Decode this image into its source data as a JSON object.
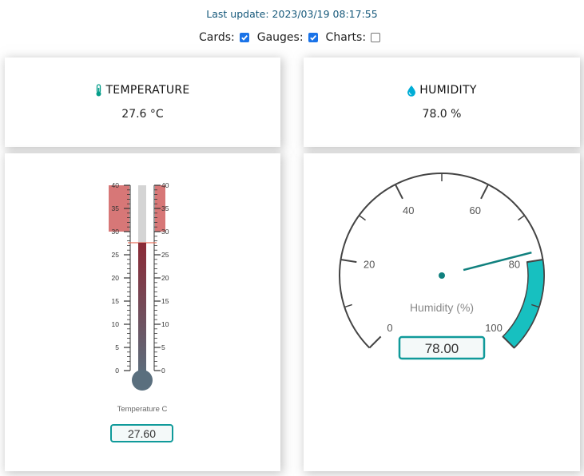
{
  "header": {
    "last_update": "Last update: 2023/03/19 08:17:55"
  },
  "toggles": [
    {
      "label": "Cards:",
      "checked": true
    },
    {
      "label": "Gauges:",
      "checked": true
    },
    {
      "label": "Charts:",
      "checked": false
    }
  ],
  "cards": {
    "temperature": {
      "title": "TEMPERATURE",
      "value": "27.6 °C",
      "icon": "thermometer-icon",
      "icon_color": "#059e8a"
    },
    "humidity": {
      "title": "HUMIDITY",
      "value": "78.0 %",
      "icon": "water-drop-icon",
      "icon_color": "#00add6"
    }
  },
  "thermometer": {
    "value": 27.6,
    "min": 0,
    "max": 40,
    "major_ticks": [
      "0",
      "5",
      "10",
      "15",
      "20",
      "25",
      "30",
      "35",
      "40"
    ],
    "highlight_from": 30,
    "highlight_to": 40,
    "caption": "Temperature C",
    "readout": "27.60",
    "colors": {
      "fill_top": "#8b2a36",
      "fill_bottom": "#5a6f7e",
      "highlight": "#c94a4a",
      "readout_border": "#109a9a"
    }
  },
  "humidity_gauge": {
    "value": 78,
    "min": 0,
    "max": 100,
    "major_ticks": [
      "0",
      "20",
      "40",
      "60",
      "80",
      "100"
    ],
    "highlight_from": 80,
    "highlight_to": 100,
    "caption": "Humidity (%)",
    "readout": "78.00",
    "colors": {
      "highlight": "#17c0c0",
      "needle": "#10807e",
      "readout_border": "#109a9a"
    }
  }
}
